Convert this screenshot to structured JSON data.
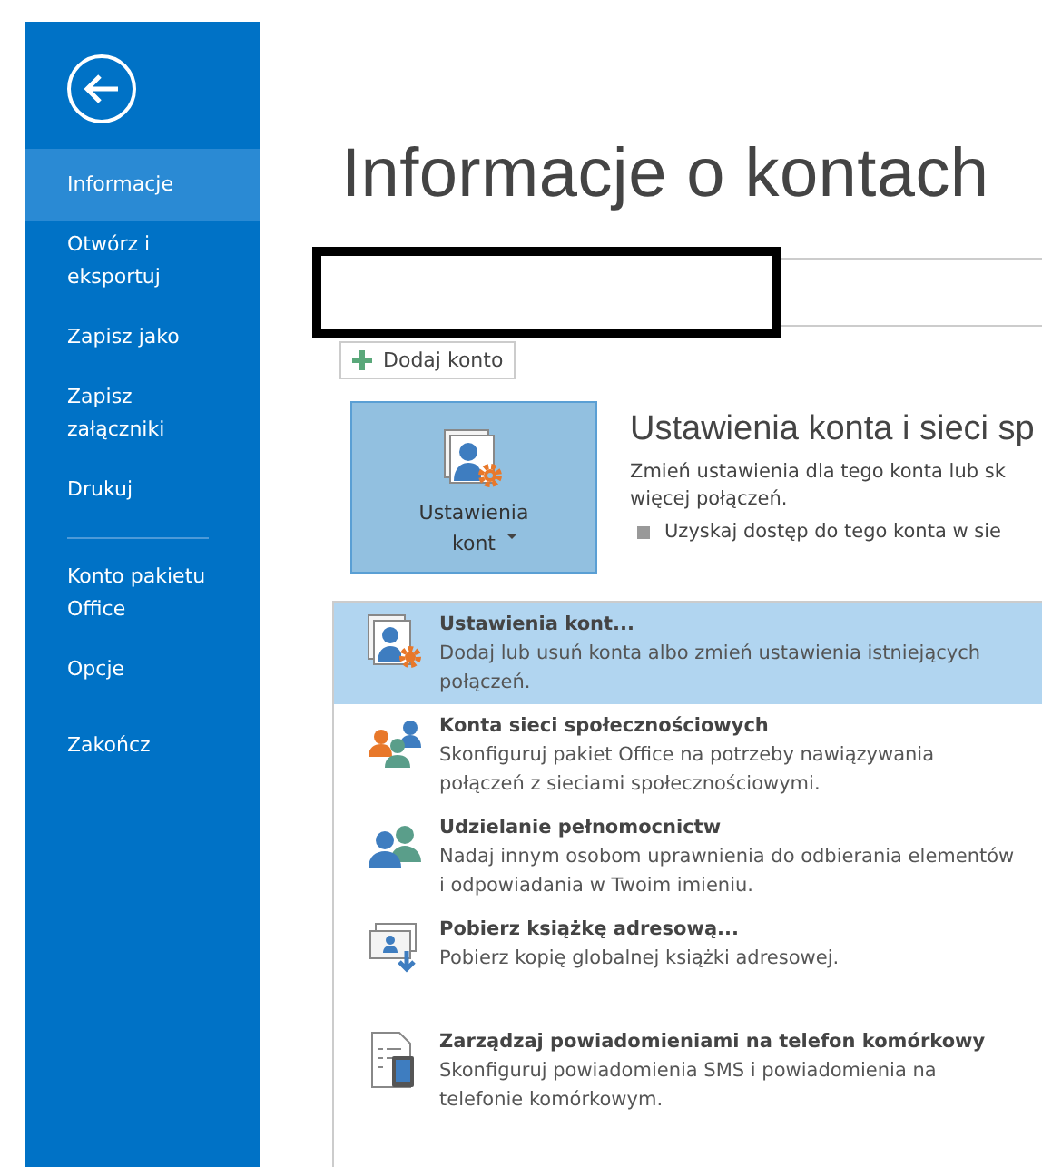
{
  "sidebar": {
    "sections": [
      {
        "items": [
          {
            "label": "Informacje",
            "selected": true
          },
          {
            "label": "Otwórz i eksportuj",
            "selected": false
          },
          {
            "label": "Zapisz jako",
            "selected": false
          },
          {
            "label": "Zapisz załączniki",
            "selected": false
          },
          {
            "label": "Drukuj",
            "selected": false
          }
        ]
      },
      {
        "items": [
          {
            "label": "Konto pakietu Office",
            "selected": false
          },
          {
            "label": "Opcje",
            "selected": false
          },
          {
            "label": "Zakończ",
            "selected": false
          }
        ]
      }
    ]
  },
  "page_title": "Informacje o kontach",
  "add_account_button": "Dodaj konto",
  "account_settings": {
    "button": "Ustawienia kont",
    "title": "Ustawienia konta i sieci sp",
    "description": "Zmień ustawienia dla tego konta lub sk",
    "description_2": "więcej połączeń.",
    "bullet": "Uzyskaj dostęp do tego konta w sie"
  },
  "menu": [
    {
      "kind": "settings",
      "title": "Ustawienia kont...",
      "description": "Dodaj lub usuń konta albo zmień ustawienia istniejących połączeń.",
      "selected": true
    },
    {
      "kind": "social",
      "title": "Konta sieci społecznościowych",
      "description": "Skonfiguruj pakiet Office na potrzeby nawiązywania połączeń z sieciami społecznościowymi.",
      "selected": false
    },
    {
      "kind": "delegate",
      "title": "Udzielanie pełnomocnictw",
      "description": "Nadaj innym osobom uprawnienia do odbierania elementów i odpowiadania w Twoim imieniu.",
      "selected": false
    },
    {
      "kind": "addressbook",
      "title": "Pobierz książkę adresową...",
      "description": "Pobierz kopię globalnej książki adresowej.",
      "selected": false
    },
    {
      "kind": "mobile",
      "title": "Zarządzaj powiadomieniami na telefon komórkowy",
      "description": "Skonfiguruj powiadomienia SMS i powiadomienia na telefonie komórkowym.",
      "selected": false
    }
  ]
}
